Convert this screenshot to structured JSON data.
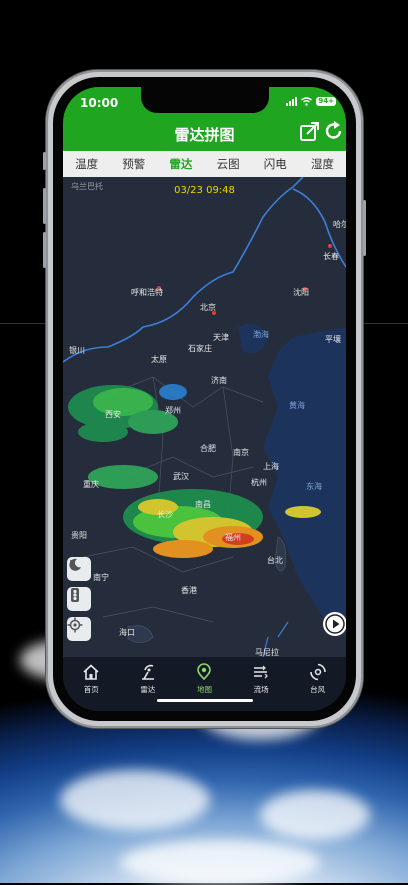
{
  "status_bar": {
    "time": "10:00",
    "battery": "94+"
  },
  "header": {
    "title": "雷达拼图",
    "share_icon": "share-icon",
    "refresh_icon": "refresh-icon"
  },
  "tabs": [
    {
      "label": "温度",
      "active": false
    },
    {
      "label": "预警",
      "active": false
    },
    {
      "label": "雷达",
      "active": true
    },
    {
      "label": "云图",
      "active": false
    },
    {
      "label": "闪电",
      "active": false
    },
    {
      "label": "湿度",
      "active": false
    }
  ],
  "map": {
    "timestamp": "03/23 09:48",
    "cities": {
      "wulanbatuo": "乌兰巴托",
      "haerbin": "哈尔",
      "changchun": "长春",
      "huhehaote": "呼和浩特",
      "shenyang": "沈阳",
      "beijing": "北京",
      "tianjin": "天津",
      "bohai": "渤海",
      "pingrang": "平壤",
      "yinchuan": "银川",
      "taiyuan": "太原",
      "shijiazhuang": "石家庄",
      "jinan": "济南",
      "xian": "西安",
      "zhengzhou": "郑州",
      "huanghai": "黄海",
      "hefei": "合肥",
      "nanjing": "南京",
      "shanghai": "上海",
      "chongqing": "重庆",
      "wuhan": "武汉",
      "hangzhou": "杭州",
      "donghai": "东海",
      "nanchang": "南昌",
      "changsha": "长沙",
      "guiyang": "贵阳",
      "fuzhou": "福州",
      "taibei": "台北",
      "nanning": "南宁",
      "xianggang": "香港",
      "haikou": "海口",
      "manila": "马尼拉"
    }
  },
  "tools": {
    "night": "night-mode-icon",
    "traffic": "traffic-light-icon",
    "locate": "locate-icon",
    "play": "play-icon"
  },
  "nav": [
    {
      "label": "首页",
      "icon": "home-icon",
      "active": false
    },
    {
      "label": "雷达",
      "icon": "radar-icon",
      "active": false
    },
    {
      "label": "地图",
      "icon": "map-pin-icon",
      "active": true
    },
    {
      "label": "流场",
      "icon": "wind-flow-icon",
      "active": false
    },
    {
      "label": "台风",
      "icon": "typhoon-icon",
      "active": false
    }
  ]
}
